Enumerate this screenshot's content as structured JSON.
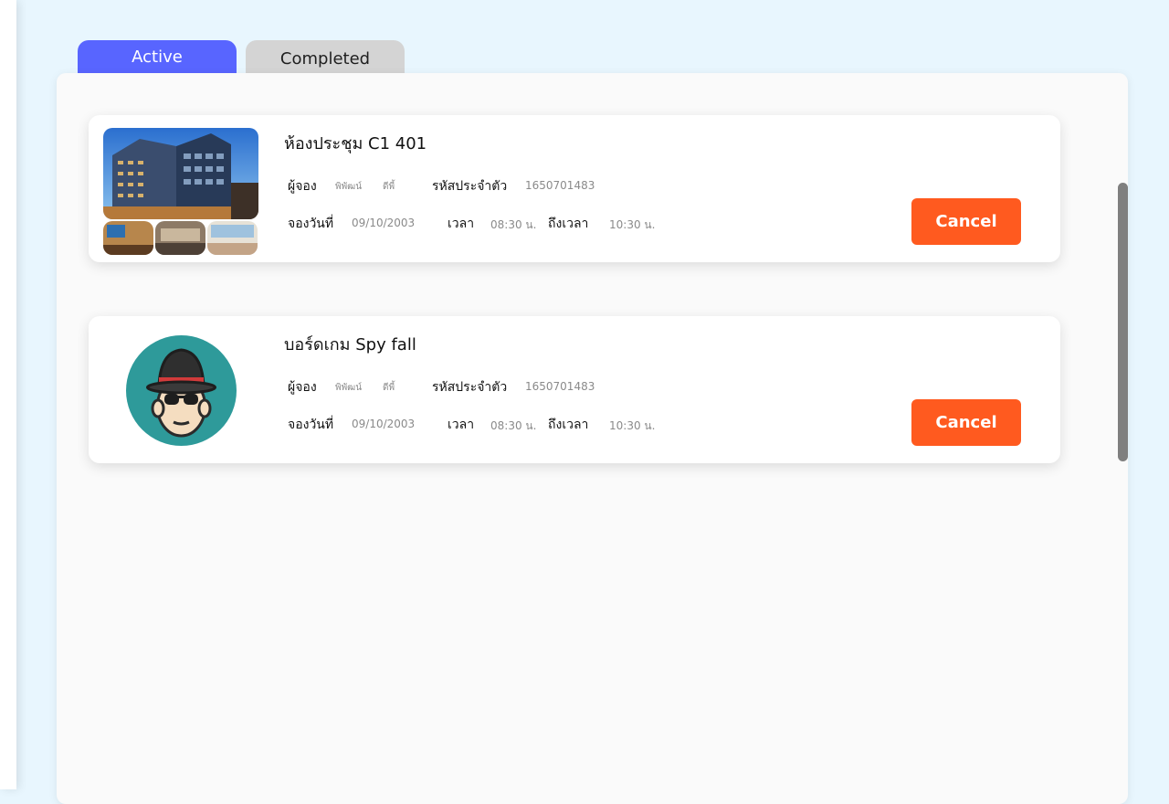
{
  "tabs": {
    "active": "Active",
    "completed": "Completed",
    "selected": "Active"
  },
  "colors": {
    "accent": "#5865ff",
    "cancel": "#ff5a1f",
    "tab_inactive": "#d4d4d4",
    "avatar_bg": "#2e9a9a"
  },
  "bookings": [
    {
      "title": "ห้องประชุม C1 401",
      "image": "hotel-building-photo",
      "booker_label": "ผู้จอง",
      "booker_first": "พิพัฒน์",
      "booker_last": "ดีพี้",
      "id_label": "รหัสประจำตัว",
      "id_value": "1650701483",
      "date_label": "จองวันที่",
      "date_value": "09/10/2003",
      "time_label": "เวลา",
      "time_value": "08:30 น.",
      "to_label": "ถึงเวลา",
      "to_value": "10:30 น.",
      "cancel_label": "Cancel"
    },
    {
      "title": "บอร์ดเกม Spy fall",
      "image": "spy-avatar-icon",
      "booker_label": "ผู้จอง",
      "booker_first": "พิพัฒน์",
      "booker_last": "ดีพี้",
      "id_label": "รหัสประจำตัว",
      "id_value": "1650701483",
      "date_label": "จองวันที่",
      "date_value": "09/10/2003",
      "time_label": "เวลา",
      "time_value": "08:30 น.",
      "to_label": "ถึงเวลา",
      "to_value": "10:30 น.",
      "cancel_label": "Cancel"
    }
  ]
}
